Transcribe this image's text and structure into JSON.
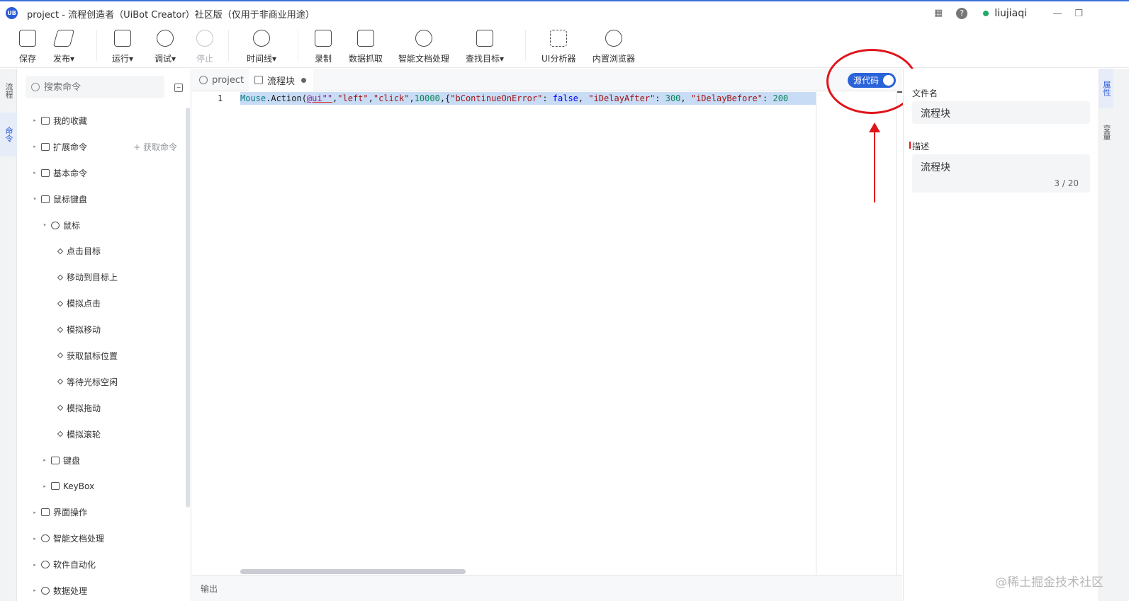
{
  "window": {
    "logo_text": "UB",
    "title": "project - 流程创造者（UiBot Creator）社区版（仅用于非商业用途）",
    "user": "liujiaqi",
    "help_icon": "?",
    "apps_icon": "▦",
    "minimize": "—",
    "restore": "❐",
    "caret": "⌄"
  },
  "toolbar": {
    "items": [
      {
        "label": "保存",
        "icon": "save-icon"
      },
      {
        "label": "发布▾",
        "icon": "publish-icon"
      },
      {
        "label": "运行▾",
        "icon": "run-icon"
      },
      {
        "label": "调试▾",
        "icon": "debug-icon"
      },
      {
        "label": "停止",
        "icon": "stop-icon",
        "disabled": true
      },
      {
        "label": "时间线▾",
        "icon": "clock-icon"
      },
      {
        "label": "录制",
        "icon": "record-icon"
      },
      {
        "label": "数据抓取",
        "icon": "data-scrape-icon"
      },
      {
        "label": "智能文档处理",
        "icon": "ai-doc-icon"
      },
      {
        "label": "查找目标▾",
        "icon": "find-target-icon"
      },
      {
        "label": "UI分析器",
        "icon": "ui-analyzer-icon"
      },
      {
        "label": "内置浏览器",
        "icon": "browser-icon"
      }
    ]
  },
  "left_rail": {
    "items": [
      "流程",
      "命令"
    ]
  },
  "command_panel": {
    "search_placeholder": "搜索命令",
    "get_command": "+ 获取命令",
    "tree": [
      {
        "label": "我的收藏",
        "level": 0,
        "arrow": "▸"
      },
      {
        "label": "扩展命令",
        "level": 0,
        "arrow": "▸"
      },
      {
        "label": "基本命令",
        "level": 0,
        "arrow": "▸"
      },
      {
        "label": "鼠标键盘",
        "level": 0,
        "arrow": "▾"
      },
      {
        "label": "鼠标",
        "level": 1,
        "arrow": "▾"
      },
      {
        "label": "点击目标",
        "level": 2
      },
      {
        "label": "移动到目标上",
        "level": 2
      },
      {
        "label": "模拟点击",
        "level": 2
      },
      {
        "label": "模拟移动",
        "level": 2
      },
      {
        "label": "获取鼠标位置",
        "level": 2
      },
      {
        "label": "等待光标空闲",
        "level": 2
      },
      {
        "label": "模拟拖动",
        "level": 2
      },
      {
        "label": "模拟滚轮",
        "level": 2
      },
      {
        "label": "键盘",
        "level": 1,
        "arrow": "▸"
      },
      {
        "label": "KeyBox",
        "level": 1,
        "arrow": "▸"
      },
      {
        "label": "界面操作",
        "level": 0,
        "arrow": "▸"
      },
      {
        "label": "智能文档处理",
        "level": 0,
        "arrow": "▸"
      },
      {
        "label": "软件自动化",
        "level": 0,
        "arrow": "▸"
      },
      {
        "label": "数据处理",
        "level": 0,
        "arrow": "▸"
      }
    ]
  },
  "editor": {
    "tabs": [
      {
        "label": "project"
      },
      {
        "label": "流程块"
      }
    ],
    "source_toggle": "源代码",
    "line_number": "1",
    "code": {
      "kw1": "Mouse",
      "t1": ".Action(",
      "ui": "@ui\"\"",
      "t2": ",",
      "s1": "\"left\"",
      "t3": ",",
      "s2": "\"click\"",
      "t4": ",",
      "n1": "10000",
      "t5": ",{",
      "s3": "\"bContinueOnError\"",
      "t6": ": ",
      "b1": "false",
      "t7": ", ",
      "s4": "\"iDelayAfter\"",
      "t8": ": ",
      "n2": "300",
      "t9": ", ",
      "s5": "\"iDelayBefore\"",
      "t10": ": ",
      "n3": "200"
    },
    "output_label": "输出"
  },
  "properties": {
    "filename_label": "文件名",
    "filename_value": "流程块",
    "desc_label": "描述",
    "desc_value": "流程块",
    "counter": "3 / 20"
  },
  "right_rail": {
    "items": [
      "属性",
      "变量"
    ]
  },
  "watermark": "@稀土掘金技术社区"
}
